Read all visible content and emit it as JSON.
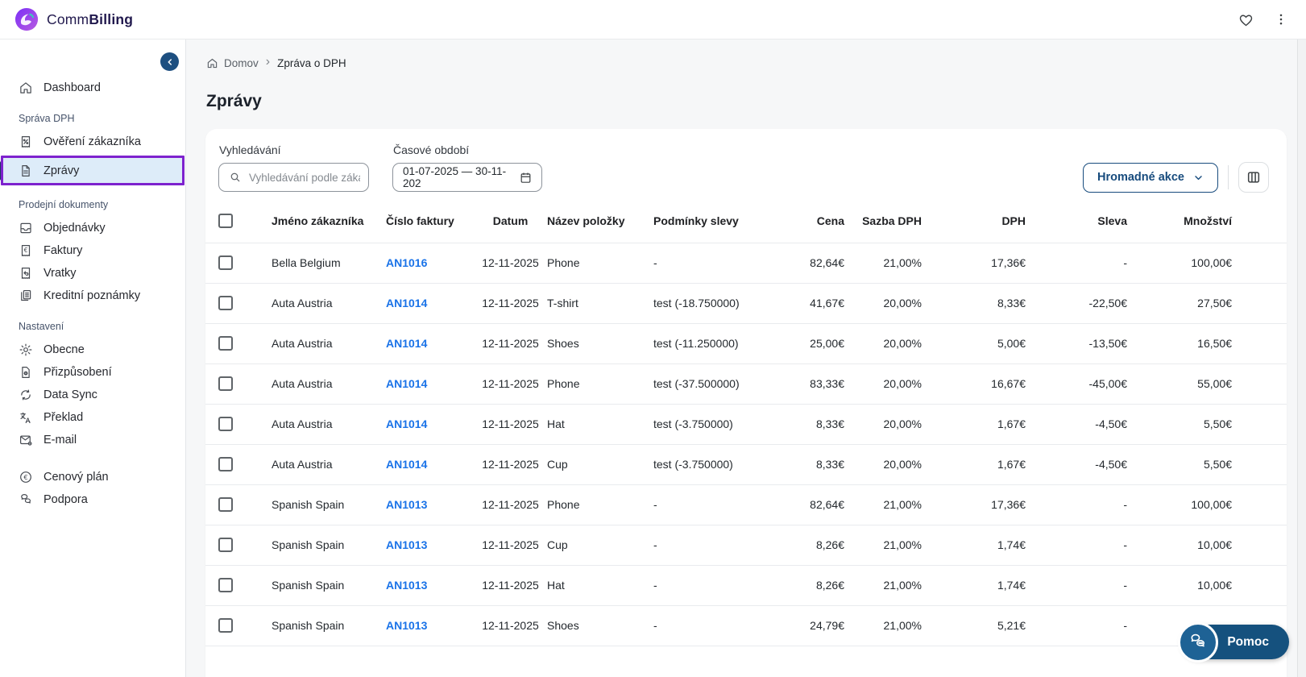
{
  "topbar": {
    "brand_regular": "Comm",
    "brand_bold": "Billing",
    "icons": [
      "heart-icon",
      "kebab-menu-icon"
    ]
  },
  "sidebar": {
    "sections": [
      {
        "label": null,
        "items": [
          {
            "id": "dashboard",
            "label": "Dashboard",
            "icon": "home-icon",
            "active": false
          }
        ]
      },
      {
        "label": "Správa DPH",
        "items": [
          {
            "id": "overeni-zakaznika",
            "label": "Ověření zákazníka",
            "icon": "document-percent-icon",
            "active": false
          },
          {
            "id": "zpravy",
            "label": "Zprávy",
            "icon": "document-icon",
            "active": true
          }
        ]
      },
      {
        "label": "Prodejní dokumenty",
        "items": [
          {
            "id": "objednavky",
            "label": "Objednávky",
            "icon": "inbox-icon",
            "active": false
          },
          {
            "id": "faktury",
            "label": "Faktury",
            "icon": "receipt-euro-icon",
            "active": false
          },
          {
            "id": "vratky",
            "label": "Vratky",
            "icon": "receipt-return-icon",
            "active": false
          },
          {
            "id": "kreditni-poznamky",
            "label": "Kreditní poznámky",
            "icon": "copy-document-icon",
            "active": false
          }
        ]
      },
      {
        "label": "Nastavení",
        "items": [
          {
            "id": "obecne",
            "label": "Obecne",
            "icon": "gear-icon",
            "active": false
          },
          {
            "id": "prizpusobeni",
            "label": "Přizpůsobení",
            "icon": "file-gear-icon",
            "active": false
          },
          {
            "id": "data-sync",
            "label": "Data Sync",
            "icon": "sync-icon",
            "active": false
          },
          {
            "id": "preklad",
            "label": "Překlad",
            "icon": "translate-icon",
            "active": false
          },
          {
            "id": "e-mail",
            "label": "E-mail",
            "icon": "mail-gear-icon",
            "active": false
          }
        ]
      },
      {
        "label": null,
        "items": [
          {
            "id": "cenovy-plan",
            "label": "Cenový plán",
            "icon": "euro-circle-icon",
            "active": false
          },
          {
            "id": "podpora",
            "label": "Podpora",
            "icon": "chat-bubbles-icon",
            "active": false
          }
        ]
      }
    ]
  },
  "breadcrumb": {
    "home_label": "Domov",
    "current_label": "Zpráva o DPH"
  },
  "page": {
    "title": "Zprávy"
  },
  "filters": {
    "search_label": "Vyhledávání",
    "search_placeholder": "Vyhledávání podle zákaz",
    "period_label": "Časové období",
    "period_value": "01-07-2025 — 30-11-202",
    "bulk_actions_label": "Hromadné akce"
  },
  "table": {
    "columns": [
      {
        "key": "customer",
        "label": "Jméno zákazníka",
        "align": "left"
      },
      {
        "key": "invoice",
        "label": "Číslo faktury",
        "align": "left"
      },
      {
        "key": "date",
        "label": "Datum",
        "align": "center"
      },
      {
        "key": "item",
        "label": "Název položky",
        "align": "left"
      },
      {
        "key": "terms",
        "label": "Podmínky slevy",
        "align": "left"
      },
      {
        "key": "price",
        "label": "Cena",
        "align": "right"
      },
      {
        "key": "vat_rate",
        "label": "Sazba DPH",
        "align": "right"
      },
      {
        "key": "vat",
        "label": "DPH",
        "align": "right"
      },
      {
        "key": "discount",
        "label": "Sleva",
        "align": "right"
      },
      {
        "key": "amount",
        "label": "Množství",
        "align": "right"
      }
    ],
    "rows": [
      {
        "customer": "Bella Belgium",
        "invoice": "AN1016",
        "date": "12-11-2025",
        "item": "Phone",
        "terms": "-",
        "price": "82,64€",
        "vat_rate": "21,00%",
        "vat": "17,36€",
        "discount": "-",
        "amount": "100,00€"
      },
      {
        "customer": "Auta Austria",
        "invoice": "AN1014",
        "date": "12-11-2025",
        "item": "T-shirt",
        "terms": "test (-18.750000)",
        "price": "41,67€",
        "vat_rate": "20,00%",
        "vat": "8,33€",
        "discount": "-22,50€",
        "amount": "27,50€"
      },
      {
        "customer": "Auta Austria",
        "invoice": "AN1014",
        "date": "12-11-2025",
        "item": "Shoes",
        "terms": "test (-11.250000)",
        "price": "25,00€",
        "vat_rate": "20,00%",
        "vat": "5,00€",
        "discount": "-13,50€",
        "amount": "16,50€"
      },
      {
        "customer": "Auta Austria",
        "invoice": "AN1014",
        "date": "12-11-2025",
        "item": "Phone",
        "terms": "test (-37.500000)",
        "price": "83,33€",
        "vat_rate": "20,00%",
        "vat": "16,67€",
        "discount": "-45,00€",
        "amount": "55,00€"
      },
      {
        "customer": "Auta Austria",
        "invoice": "AN1014",
        "date": "12-11-2025",
        "item": "Hat",
        "terms": "test (-3.750000)",
        "price": "8,33€",
        "vat_rate": "20,00%",
        "vat": "1,67€",
        "discount": "-4,50€",
        "amount": "5,50€"
      },
      {
        "customer": "Auta Austria",
        "invoice": "AN1014",
        "date": "12-11-2025",
        "item": "Cup",
        "terms": "test (-3.750000)",
        "price": "8,33€",
        "vat_rate": "20,00%",
        "vat": "1,67€",
        "discount": "-4,50€",
        "amount": "5,50€"
      },
      {
        "customer": "Spanish Spain",
        "invoice": "AN1013",
        "date": "12-11-2025",
        "item": "Phone",
        "terms": "-",
        "price": "82,64€",
        "vat_rate": "21,00%",
        "vat": "17,36€",
        "discount": "-",
        "amount": "100,00€"
      },
      {
        "customer": "Spanish Spain",
        "invoice": "AN1013",
        "date": "12-11-2025",
        "item": "Cup",
        "terms": "-",
        "price": "8,26€",
        "vat_rate": "21,00%",
        "vat": "1,74€",
        "discount": "-",
        "amount": "10,00€"
      },
      {
        "customer": "Spanish Spain",
        "invoice": "AN1013",
        "date": "12-11-2025",
        "item": "Hat",
        "terms": "-",
        "price": "8,26€",
        "vat_rate": "21,00%",
        "vat": "1,74€",
        "discount": "-",
        "amount": "10,00€"
      },
      {
        "customer": "Spanish Spain",
        "invoice": "AN1013",
        "date": "12-11-2025",
        "item": "Shoes",
        "terms": "-",
        "price": "24,79€",
        "vat_rate": "21,00%",
        "vat": "5,21€",
        "discount": "-",
        "amount": ""
      }
    ]
  },
  "help": {
    "label": "Pomoc"
  },
  "colors": {
    "brand_purple": "#8b2fc9",
    "highlight_purple": "#7e22ce",
    "active_item_bg": "#ddecf9",
    "primary_blue": "#174b7d",
    "help_button_bg": "#15517e",
    "link_blue": "#1a73e8"
  }
}
